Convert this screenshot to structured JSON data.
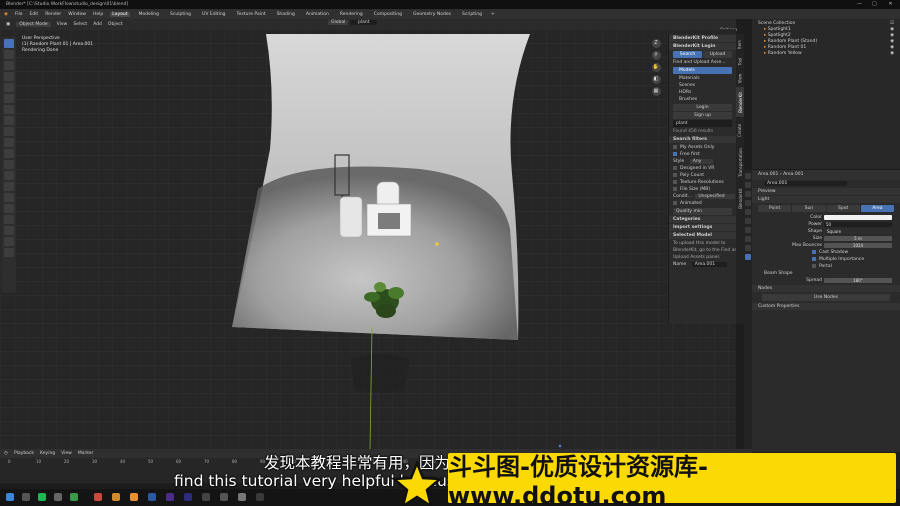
{
  "window": {
    "title": "Blender* [C:\\Studio WorkFlow\\studio_design\\01\\blend]",
    "controls": [
      "—",
      "□",
      "✕"
    ]
  },
  "menubar": {
    "items": [
      "File",
      "Edit",
      "Render",
      "Window",
      "Help"
    ],
    "workspaces": [
      "Layout",
      "Modeling",
      "Sculpting",
      "UV Editing",
      "Texture Paint",
      "Shading",
      "Animation",
      "Rendering",
      "Compositing",
      "Geometry Nodes",
      "Scripting"
    ],
    "active_workspace": "Layout",
    "scene_label": "Scene",
    "view_layer_label": "ViewLayer"
  },
  "viewport_header": {
    "mode": "Object Mode",
    "menus": [
      "View",
      "Select",
      "Add",
      "Object"
    ],
    "orientation": "Global",
    "search_value": "plant",
    "options_label": "Options"
  },
  "viewport_overlay": {
    "line1": "User Perspective",
    "line2": "(1) Random Plant 01 | Area.001",
    "line3": "Rendering Done"
  },
  "gizmo": {
    "axis_label": "Z"
  },
  "npanel": {
    "profile_label": "BlenderKit Profile",
    "login_label": "BlenderKit Login",
    "tabs": [
      "Search",
      "Upload"
    ],
    "find_label": "Find and Upload Asse...",
    "asset_types": [
      "Models",
      "Materials",
      "Scenes",
      "HDRs",
      "Brushes"
    ],
    "login_button": "Login",
    "signup_button": "Sign up",
    "search_value": "plant",
    "results_label": "Found 456 results",
    "filters_label": "Search filters",
    "my_assets_label": "My Assets Only",
    "free_first_label": "Free first",
    "style_label": "Style",
    "style_value": "Any",
    "designed_in_vr_label": "Designed in VR",
    "poly_count_label": "Poly Count",
    "texture_res_label": "Texture Resolutions",
    "file_size_label": "File Size (MB)",
    "condition_label": "Condit...",
    "condition_value": "Unspecified",
    "animated_label": "Animated",
    "quality_label": "Quality min",
    "categories_label": "Categories",
    "import_settings_label": "Import settings",
    "selected_model_label": "Selected Model",
    "upload_hint": [
      "To upload this model to",
      "BlenderKit, go to the Find and",
      "Upload Assets panel."
    ],
    "name_label": "Name",
    "name_value": "Area.001"
  },
  "vertical_tabs": [
    "Item",
    "Tool",
    "View",
    "BlenderKit",
    "Create",
    "Transportation",
    "Blenderkit"
  ],
  "outliner": {
    "title": "Scene Collection",
    "items": [
      "Spotlight1",
      "Spotlight2",
      "Random Plant (Stand)",
      "Random Plant 01",
      "Random Yellow"
    ]
  },
  "properties": {
    "breadcrumb": [
      "Area.001",
      "Area.001"
    ],
    "datablock_name": "Area.001",
    "preview_label": "Preview",
    "light_label": "Light",
    "light_types": [
      "Point",
      "Sun",
      "Spot",
      "Area"
    ],
    "active_light_type": "Area",
    "color_label": "Color",
    "power_label": "Power",
    "power_value": "50",
    "shape_label": "Shape",
    "shape_value": "Square",
    "size_label": "Size",
    "size_value": "5 m",
    "max_bounces_label": "Max Bounces",
    "max_bounces_value": "1024",
    "cast_shadow_label": "Cast Shadow",
    "multiple_importance_label": "Multiple Importance",
    "portal_label": "Portal",
    "beam_shape_label": "Beam Shape",
    "spread_label": "Spread",
    "spread_value": "180°",
    "nodes_label": "Nodes",
    "use_nodes_label": "Use Nodes",
    "custom_props_label": "Custom Properties"
  },
  "timeline": {
    "menus": [
      "Playback",
      "Keying",
      "View",
      "Marker"
    ],
    "ticks": [
      "0",
      "10",
      "20",
      "30",
      "40",
      "50",
      "60",
      "70",
      "80",
      "90",
      "100",
      "110",
      "120",
      "130",
      "140",
      "150",
      "160",
      "170",
      "180",
      "190",
      "200",
      "210",
      "220",
      "230",
      "240",
      "250"
    ]
  },
  "subtitles": {
    "chinese": "发现本教程非常有用，因为",
    "english": "find this tutorial very helpful because"
  },
  "watermark": {
    "text": "斗斗图-优质设计资源库-www.ddotu.com"
  },
  "colors": {
    "accent": "#4772b3",
    "watermark_bg": "#fbd902",
    "orange_object": "#e8912e"
  }
}
